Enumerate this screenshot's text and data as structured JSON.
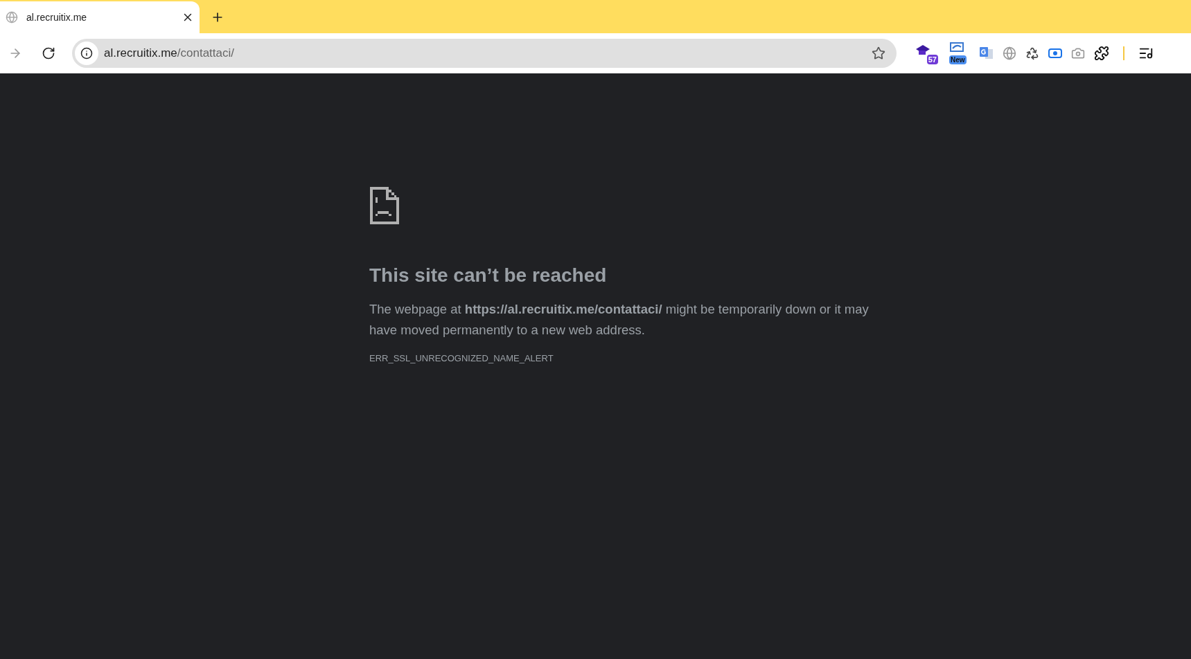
{
  "tab": {
    "title": "al.recruitix.me",
    "selected": true
  },
  "address_bar": {
    "host": "al.recruitix.me",
    "path": "/contattaci/"
  },
  "extensions": [
    {
      "kind": "cap",
      "badge": "57"
    },
    {
      "kind": "reader",
      "badge": "New"
    },
    {
      "kind": "translate"
    },
    {
      "kind": "globe"
    },
    {
      "kind": "recycle"
    },
    {
      "kind": "record"
    },
    {
      "kind": "camera"
    },
    {
      "kind": "puzzle"
    }
  ],
  "error_page": {
    "title": "This site can’t be reached",
    "message": "The webpage at **https://al.recruitix.me/contattaci/** might be temporarily down or it may have moved permanently to a new web address.",
    "code": "ERR_SSL_UNRECOGNIZED_NAME_ALERT"
  }
}
